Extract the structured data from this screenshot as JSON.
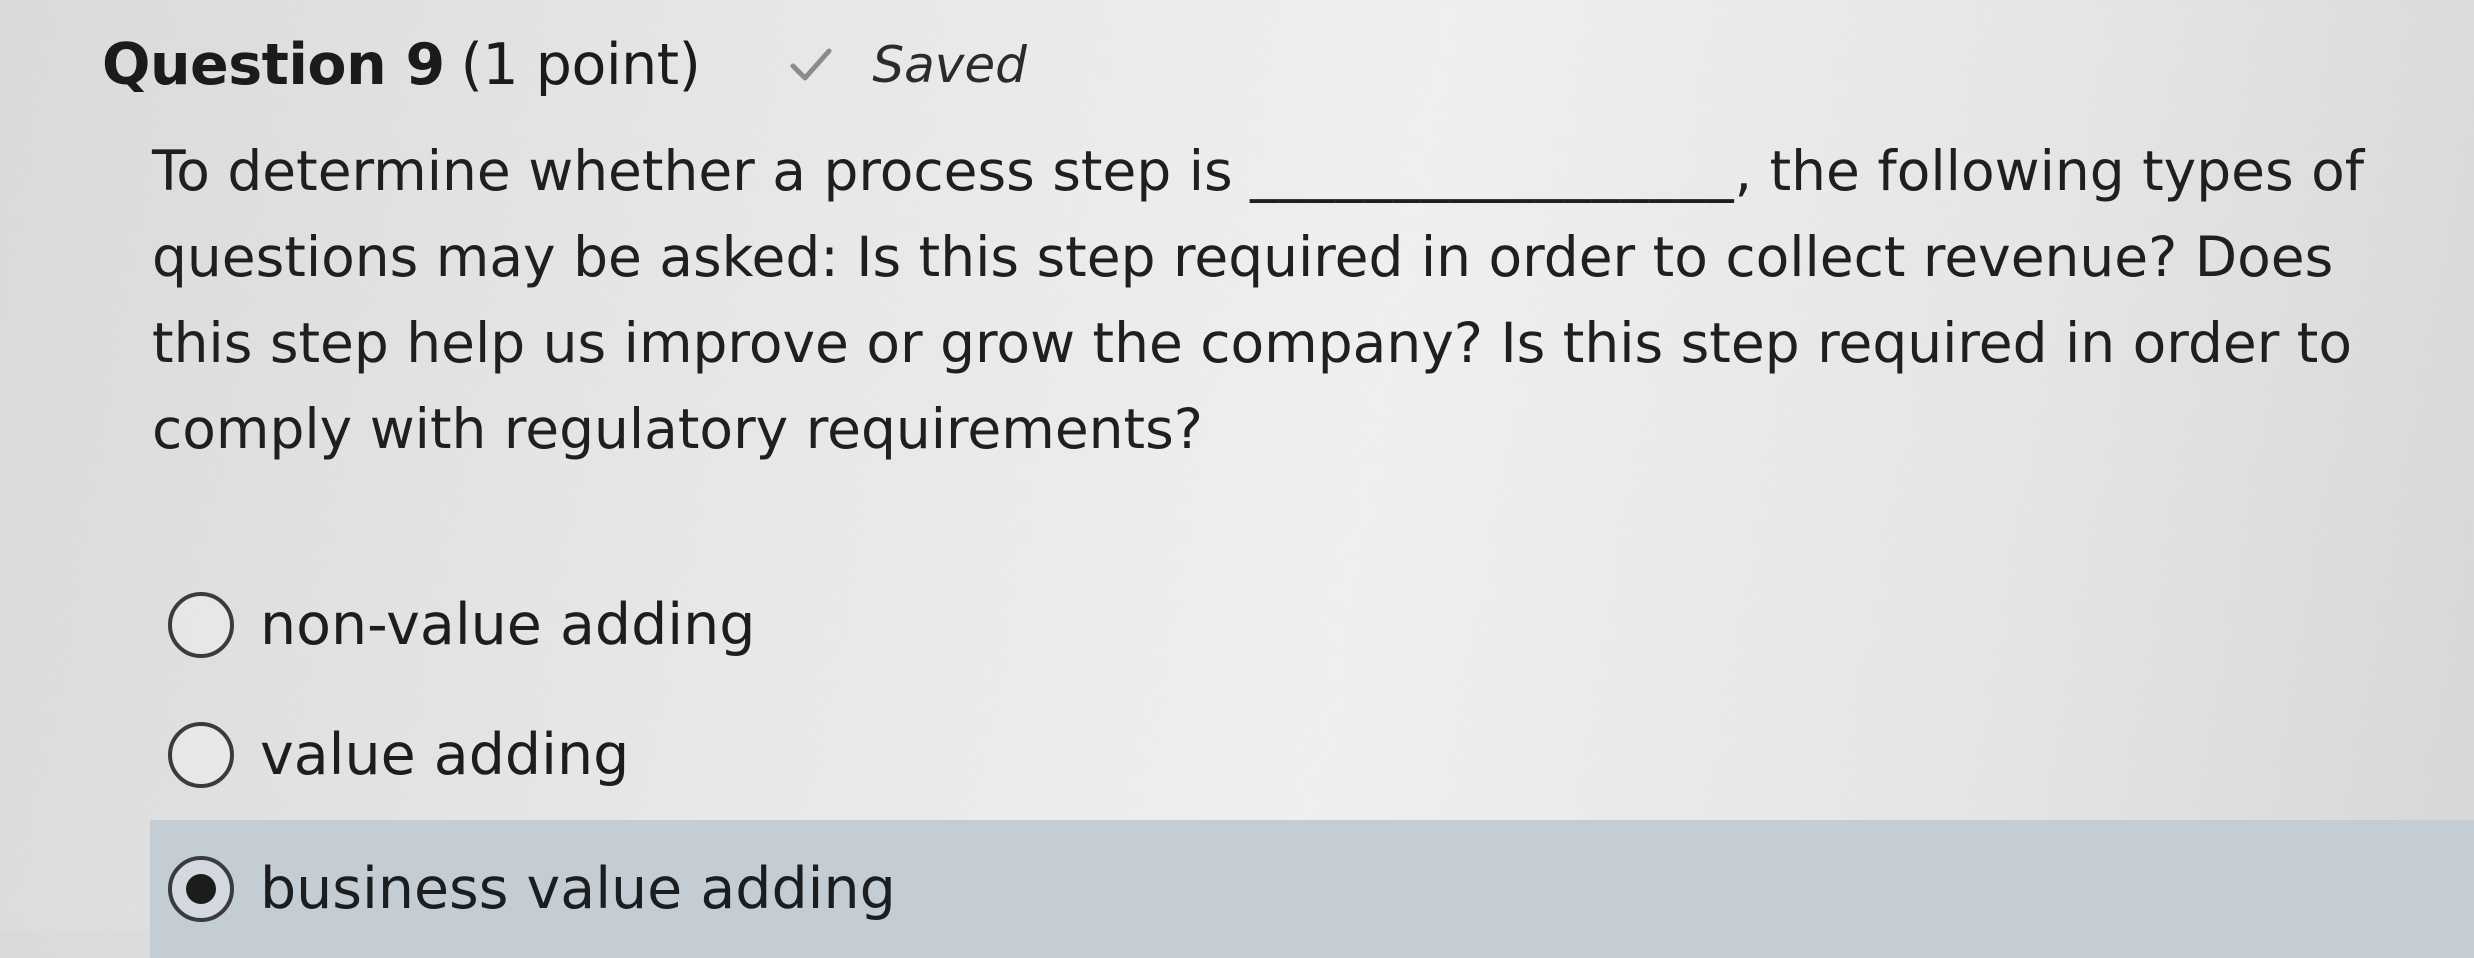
{
  "question": {
    "title": "Question 9",
    "points": "(1 point)",
    "status_icon": "checkmark-icon",
    "status_label": "Saved",
    "text_before_blank": "To determine whether a process step is ",
    "blank": "_________________",
    "text_after_blank": ", the following types of questions may be asked: Is this step required in order to collect revenue? Does this step help us improve or grow the company? Is this step required in order to comply with regulatory requirements?"
  },
  "options": [
    {
      "label": "non-value adding",
      "selected": false
    },
    {
      "label": "value adding",
      "selected": false
    },
    {
      "label": "business value adding",
      "selected": true
    }
  ],
  "colors": {
    "selected_row_bg": "#c4cdd4",
    "text": "#1c1d1f",
    "checkmark": "#8a8b8d"
  }
}
